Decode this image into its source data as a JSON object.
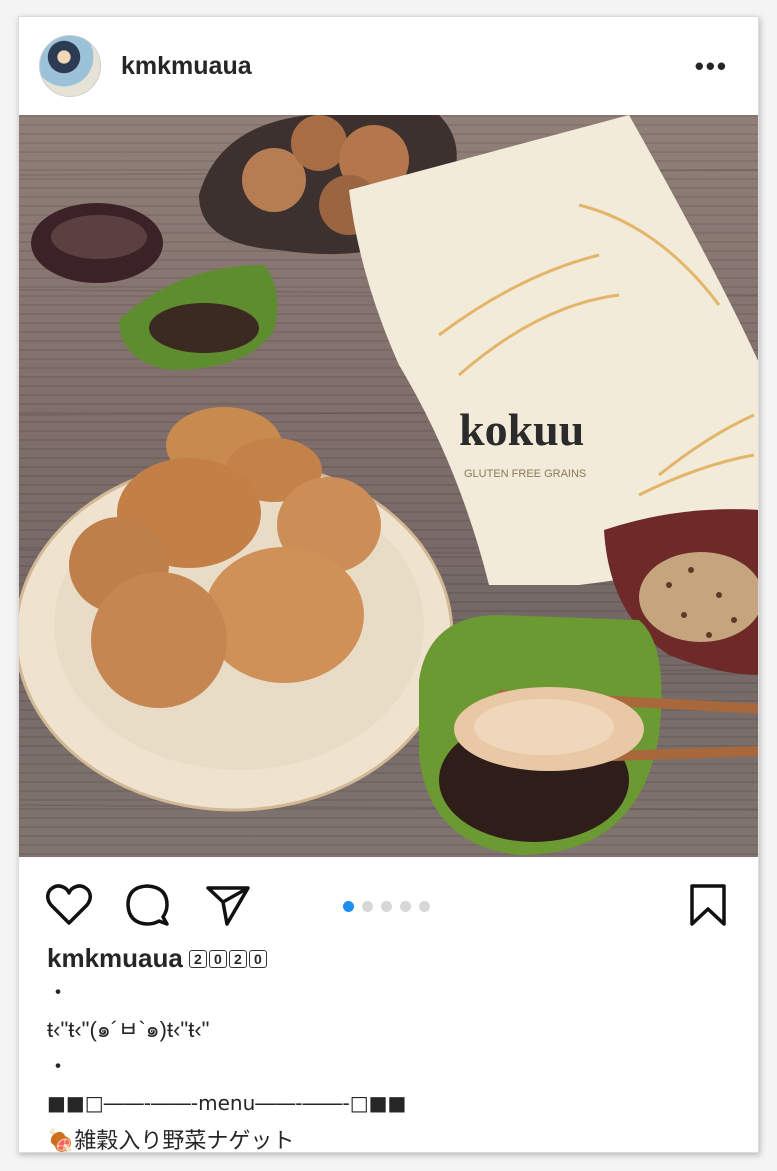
{
  "post": {
    "username": "kmkmuaua",
    "more_label": "•••",
    "photo_label": "kokuu",
    "photo_sublabel": "GLUTEN FREE GRAINS",
    "carousel": {
      "count": 5,
      "active": 1
    },
    "caption": {
      "username": "kmkmuaua",
      "badge": [
        "2",
        "0",
        "2",
        "0"
      ],
      "lines": [
        "・",
        "ŧ‹\"ŧ‹\"(๑´ㅂ`๑)ŧ‹\"ŧ‹\"",
        "・",
        "■■□――-――-menu――-――-□■■",
        "🍖雑穀入り野菜ナゲット"
      ]
    }
  },
  "colors": {
    "accent": "#1f8ef1",
    "text": "#262626",
    "dot_inactive": "#d7d7d7"
  },
  "icons": [
    "heart-icon",
    "comment-icon",
    "share-icon",
    "bookmark-icon",
    "more-icon"
  ]
}
